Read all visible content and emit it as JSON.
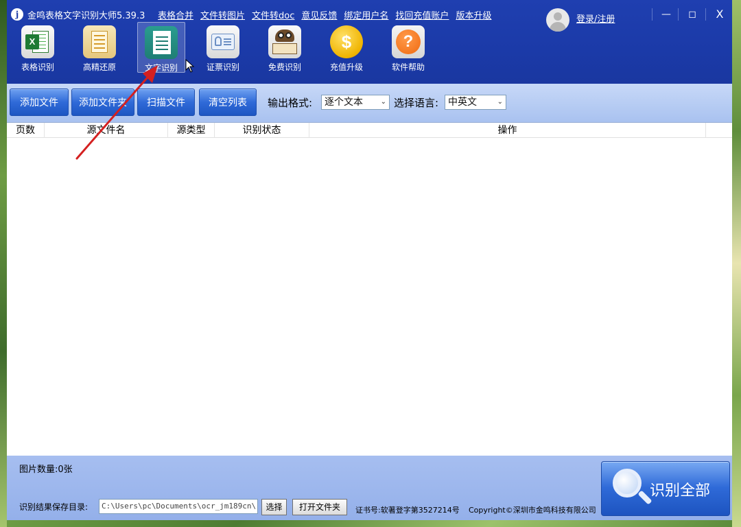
{
  "app": {
    "title": "金鸣表格文字识别大师5.39.3",
    "logo_letter": "j"
  },
  "topnav": [
    "表格合并",
    "文件转图片",
    "文件转doc",
    "意见反馈",
    "绑定用户名",
    "找回充值账户",
    "版本升级"
  ],
  "user": {
    "login_label": "登录/注册"
  },
  "window_controls": {
    "minimize": "—",
    "maximize": "◻",
    "close": "X"
  },
  "tools": [
    {
      "label": "表格识别",
      "icon": "excel-icon"
    },
    {
      "label": "高精还原",
      "icon": "layout-restore-icon"
    },
    {
      "label": "文字识别",
      "icon": "text-document-icon",
      "active": true
    },
    {
      "label": "证票识别",
      "icon": "id-card-icon"
    },
    {
      "label": "免费识别",
      "icon": "owl-book-icon"
    },
    {
      "label": "充值升级",
      "icon": "dollar-coin-icon"
    },
    {
      "label": "软件帮助",
      "icon": "help-question-icon"
    }
  ],
  "toolbar": {
    "add_file": "添加文件",
    "add_folder": "添加文件夹",
    "scan_file": "扫描文件",
    "clear_list": "清空列表",
    "output_format_label": "输出格式:",
    "output_format_value": "逐个文本",
    "language_label": "选择语言:",
    "language_value": "中英文"
  },
  "table": {
    "columns": [
      "页数",
      "源文件名",
      "源类型",
      "识别状态",
      "操作"
    ],
    "rows": []
  },
  "footer": {
    "image_count": "图片数量:0张",
    "save_dir_label": "识别结果保存目录:",
    "save_dir_value": "C:\\Users\\pc\\Documents\\ocr_jm189cn\\",
    "choose_button": "选择",
    "open_folder_button": "打开文件夹",
    "cert": "证书号:软著登字第3527214号",
    "copyright": "Copyright©深圳市金鸣科技有限公司",
    "recognize_all": "识别全部"
  },
  "colors": {
    "title_bar": "#1b3aa8",
    "toolbar_bg": "#b7cdf3",
    "button_blue": "#2f6ad8",
    "annotation_arrow": "#d42020"
  }
}
